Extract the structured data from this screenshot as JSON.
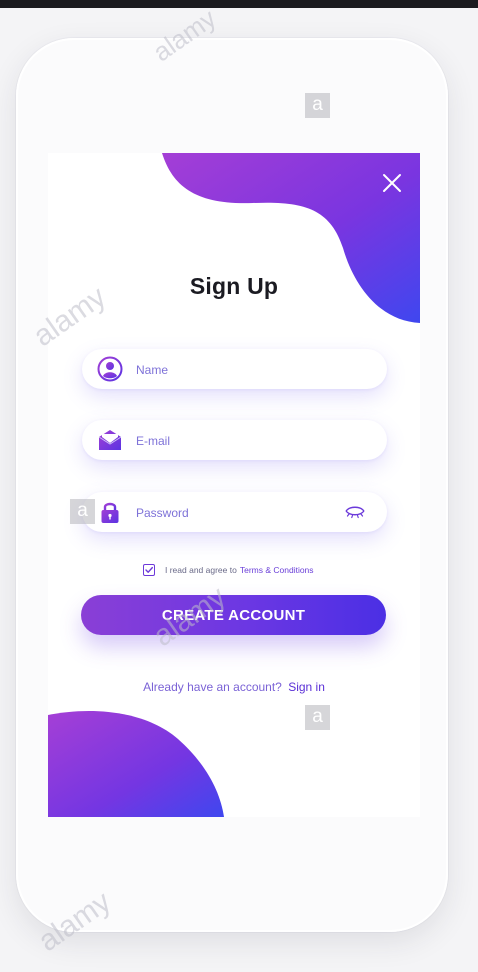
{
  "page": {
    "title": "Sign Up",
    "close_icon": "close-icon"
  },
  "form": {
    "name": {
      "placeholder": "Name",
      "value": "",
      "icon": "user-icon"
    },
    "email": {
      "placeholder": "E-mail",
      "value": "",
      "icon": "mail-icon"
    },
    "password": {
      "placeholder": "Password",
      "value": "",
      "icon": "lock-icon",
      "toggle_icon": "eye-icon"
    }
  },
  "agreement": {
    "checked": true,
    "text": "I read and agree to",
    "link": "Terms & Conditions"
  },
  "create_button": "CREATE ACCOUNT",
  "footer": {
    "text": "Already have an account?",
    "link": "Sign in"
  },
  "watermark": {
    "text": "alamy",
    "letter": "a"
  },
  "colors": {
    "accent_purple": "#8a3fd6",
    "accent_blue": "#4b2fe4",
    "title": "#1b1b22",
    "placeholder": "#7e72d8"
  }
}
